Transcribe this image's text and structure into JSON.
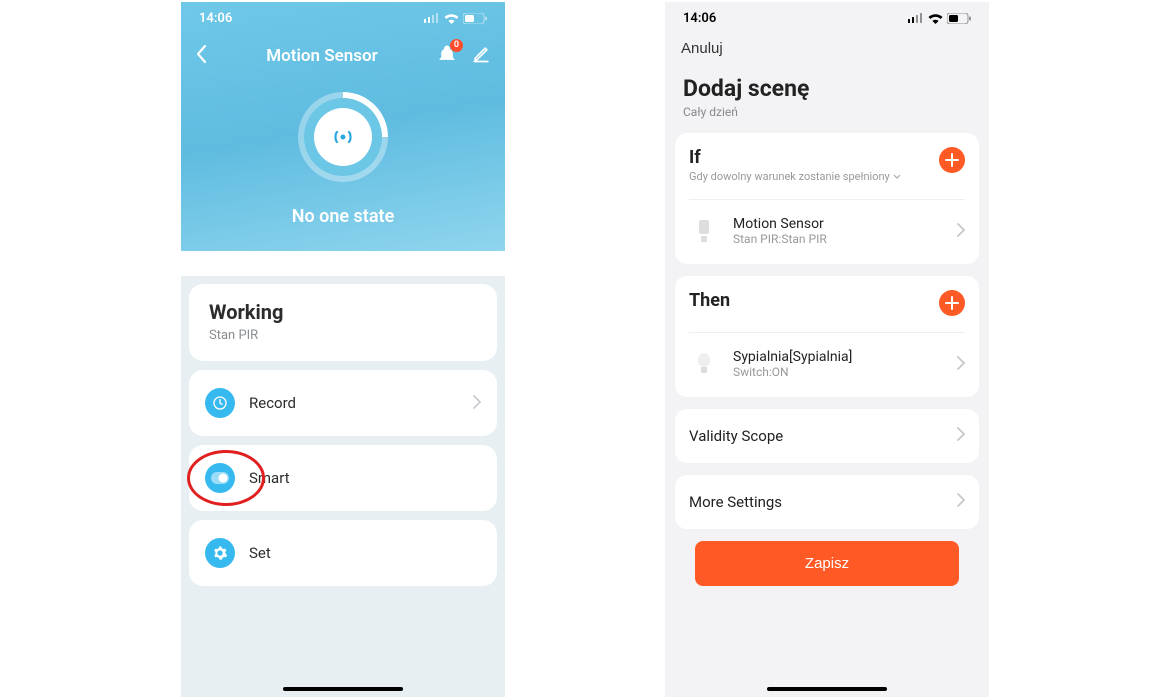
{
  "status": {
    "time": "14:06"
  },
  "left": {
    "title": "Motion Sensor",
    "badge_count": "0",
    "state_label": "No one state",
    "working_title": "Working",
    "working_sub": "Stan PIR",
    "record": "Record",
    "smart": "Smart",
    "set": "Set"
  },
  "right": {
    "cancel": "Anuluj",
    "scene_title": "Dodaj scenę",
    "scene_sub": "Cały dzień",
    "if_title": "If",
    "if_sub": "Gdy dowolny warunek zostanie spełniony",
    "if_item_title": "Motion Sensor",
    "if_item_sub": "Stan PIR:Stan PIR",
    "then_title": "Then",
    "then_item_title": "Sypialnia[Sypialnia]",
    "then_item_sub": "Switch:ON",
    "validity": "Validity Scope",
    "more": "More Settings",
    "save": "Zapisz"
  }
}
